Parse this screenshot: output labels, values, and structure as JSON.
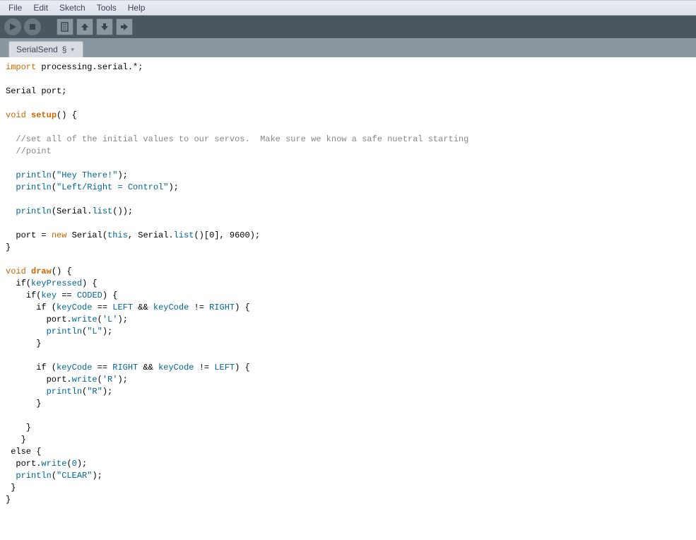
{
  "menu": {
    "items": [
      "File",
      "Edit",
      "Sketch",
      "Tools",
      "Help"
    ]
  },
  "toolbar": {
    "run": "Run",
    "stop": "Stop",
    "new": "New",
    "open": "Open",
    "save": "Save",
    "export": "Export"
  },
  "tab": {
    "name": "SerialSend",
    "dirty_marker": "§"
  },
  "code": {
    "lines": [
      {
        "t": "kw-import",
        "s": [
          "import",
          " processing.serial.*;"
        ]
      },
      {
        "t": "blank"
      },
      {
        "t": "plain",
        "s": [
          "Serial port;"
        ]
      },
      {
        "t": "blank"
      },
      {
        "t": "funcdecl",
        "kw": "void",
        "name": "setup",
        "rest": "() {"
      },
      {
        "t": "blank"
      },
      {
        "t": "comment",
        "indent": "  ",
        "text": "//set all of the initial values to our servos.  Make sure we know a safe nuetral starting"
      },
      {
        "t": "comment",
        "indent": "  ",
        "text": "//point"
      },
      {
        "t": "blank"
      },
      {
        "t": "call",
        "indent": "  ",
        "fn": "println",
        "args": "(\"Hey There!\");"
      },
      {
        "t": "call",
        "indent": "  ",
        "fn": "println",
        "args": "(\"Left/Right = Control\");"
      },
      {
        "t": "blank"
      },
      {
        "t": "call-chain",
        "indent": "  ",
        "parts": [
          "println",
          "(Serial.",
          "list",
          "());"
        ]
      },
      {
        "t": "blank"
      },
      {
        "t": "assign-new",
        "indent": "  ",
        "lhs": "port = ",
        "kw": "new",
        "mid": " Serial(",
        "this": "this",
        "rest": ", Serial.",
        "fn": "list",
        "tail": "()[0], 9600);"
      },
      {
        "t": "plain",
        "s": [
          "}"
        ]
      },
      {
        "t": "blank"
      },
      {
        "t": "funcdecl",
        "kw": "void",
        "name": "draw",
        "rest": "() {"
      },
      {
        "t": "if1",
        "indent": "  ",
        "pre": "if(",
        "var": "keyPressed",
        "post": ") {"
      },
      {
        "t": "if2",
        "indent": "    ",
        "pre": "if(",
        "var": "key",
        "mid": " == ",
        "const": "CODED",
        "post": ") {"
      },
      {
        "t": "if3",
        "indent": "      ",
        "pre": "if (",
        "v1": "keyCode",
        "m1": " == ",
        "c1": "LEFT",
        "m2": " && ",
        "v2": "keyCode",
        "m3": " != ",
        "c2": "RIGHT",
        "post": ") {"
      },
      {
        "t": "call",
        "indent": "        ",
        "fn": "port.write",
        "args": "('L');"
      },
      {
        "t": "call",
        "indent": "        ",
        "fn": "println",
        "args": "(\"L\");"
      },
      {
        "t": "plain",
        "s": [
          "      }"
        ]
      },
      {
        "t": "blank"
      },
      {
        "t": "if3",
        "indent": "      ",
        "pre": "if (",
        "v1": "keyCode",
        "m1": " == ",
        "c1": "RIGHT",
        "m2": " && ",
        "v2": "keyCode",
        "m3": " != ",
        "c2": "LEFT",
        "post": ") {"
      },
      {
        "t": "call",
        "indent": "        ",
        "fn": "port.write",
        "args": "('R');"
      },
      {
        "t": "call",
        "indent": "        ",
        "fn": "println",
        "args": "(\"R\");"
      },
      {
        "t": "plain",
        "s": [
          "      }"
        ]
      },
      {
        "t": "blank"
      },
      {
        "t": "plain",
        "s": [
          "    }"
        ]
      },
      {
        "t": "plain",
        "s": [
          "   }"
        ]
      },
      {
        "t": "plain",
        "s": [
          " else {"
        ]
      },
      {
        "t": "call",
        "indent": "  ",
        "fn": "port.write",
        "args": "(0);"
      },
      {
        "t": "call",
        "indent": "  ",
        "fn": "println",
        "args": "(\"CLEAR\");"
      },
      {
        "t": "plain",
        "s": [
          " }"
        ]
      },
      {
        "t": "plain",
        "s": [
          "}"
        ]
      }
    ]
  }
}
